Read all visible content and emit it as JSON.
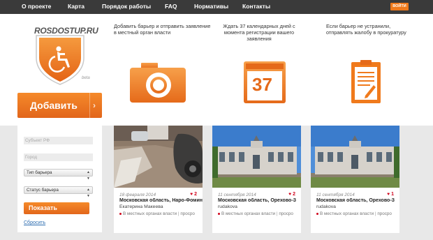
{
  "nav": {
    "items": [
      "О проекте",
      "Карта",
      "Порядок работы",
      "FAQ",
      "Нормативы",
      "Контакты"
    ],
    "login": "ВОЙТИ"
  },
  "logo": {
    "text": "ROSDOSTUP.RU",
    "beta": "beta"
  },
  "hero": {
    "add_button": "Добавить",
    "steps": [
      {
        "text": "Добавить барьер и отправить заявление в местный орган власти",
        "icon": "camera-icon"
      },
      {
        "text": "Ждать 37 календарных дней с момента регистрации вашего заявления",
        "icon": "calendar-icon",
        "calendar_number": "37"
      },
      {
        "text": "Если барьер не устранили, отправлять жалобу в прокуратуру",
        "icon": "document-icon"
      }
    ]
  },
  "filter": {
    "subject_placeholder": "Субъект РФ",
    "city_placeholder": "Город",
    "barrier_type": "Тип барьера",
    "barrier_status": "Статус барьера",
    "show_button": "Показать",
    "reset_link": "Сбросить"
  },
  "cards": [
    {
      "date": "18 февраля 2014",
      "count": "2",
      "location": "Московская область, Наро-Фомин",
      "author": "Екатерина Макеева",
      "status": "В местных органах власти",
      "extra": "просро"
    },
    {
      "date": "11 сентября 2014",
      "count": "2",
      "location": "Московская область, Орехово-З",
      "author": "rudakova",
      "status": "В местных органах власти",
      "extra": "просро"
    },
    {
      "date": "11 сентября 2014",
      "count": "1",
      "location": "Московская область, Орехово-З",
      "author": "rudakova",
      "status": "В местных органах власти",
      "extra": "просро"
    }
  ],
  "colors": {
    "accent": "#f07a1c",
    "nav_bg": "#3a3a3a",
    "heart": "#d0021b",
    "link": "#2d6db0"
  }
}
